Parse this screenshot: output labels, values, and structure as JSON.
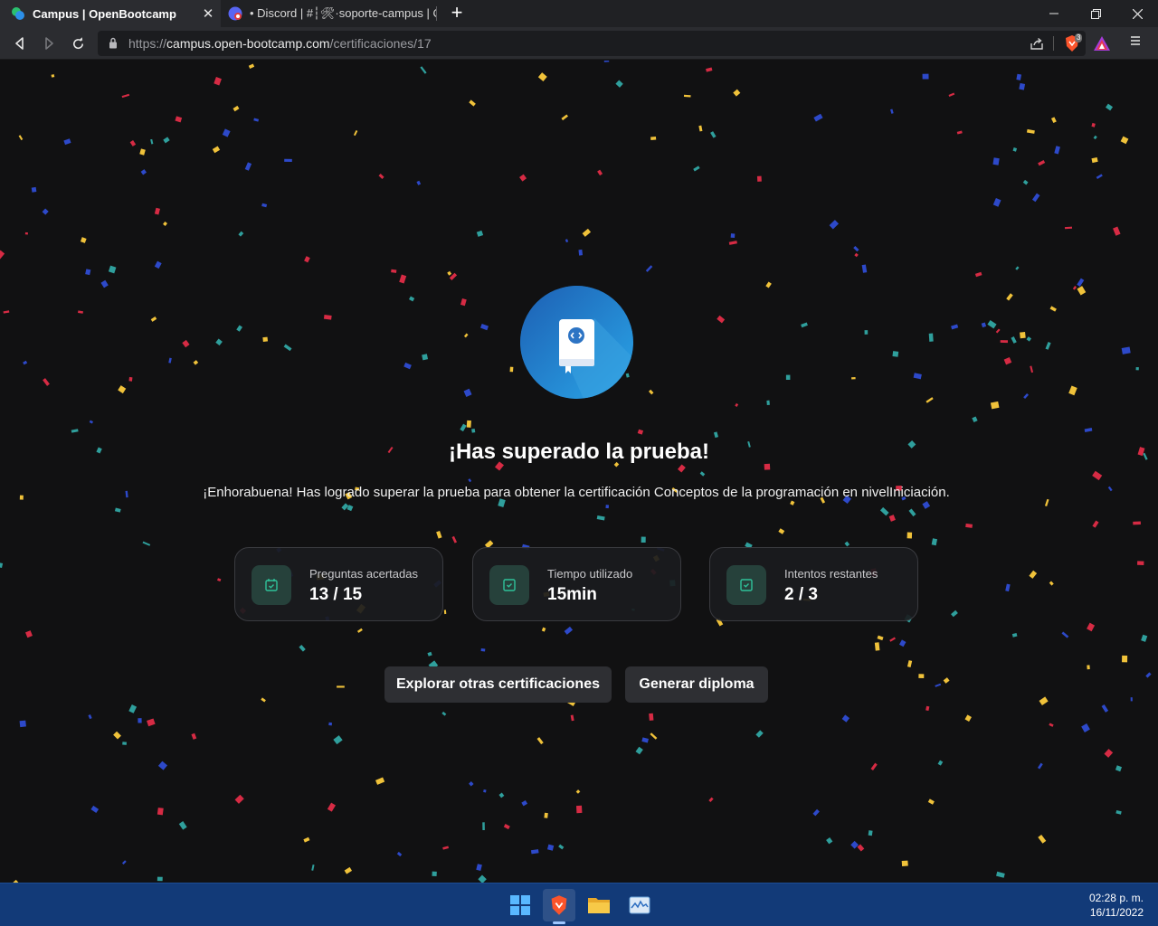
{
  "browser": {
    "tabs": [
      {
        "title": "Campus | OpenBootcamp",
        "active": true,
        "icon": "openbootcamp-favicon"
      },
      {
        "title": "• Discord | #┆🛠·soporte-campus | Op",
        "active": false,
        "icon": "discord-favicon"
      }
    ],
    "url_scheme": "https://",
    "url_host": "campus.open-bootcamp.com",
    "url_path": "/certificaciones/17",
    "shield_badge": "3"
  },
  "page": {
    "headline": "¡Has superado la prueba!",
    "message": "¡Enhorabuena! Has logrado superar la prueba para obtener la certificación Conceptos de la programación en nivelIniciación.",
    "stats": [
      {
        "label": "Preguntas acertadas",
        "value": "13 / 15"
      },
      {
        "label": "Tiempo utilizado",
        "value": "15min"
      },
      {
        "label": "Intentos restantes",
        "value": "2 / 3"
      }
    ],
    "buttons": {
      "explore": "Explorar otras certificaciones",
      "diploma": "Generar diploma"
    },
    "colors": {
      "hero_blue": "#1f6fc0",
      "stat_icon_green": "#2fc29a",
      "confetti": [
        "#d62b44",
        "#2f9f9c",
        "#2d49c9",
        "#f0c23a"
      ]
    }
  },
  "taskbar": {
    "time": "02:28 p. m.",
    "date": "16/11/2022",
    "apps": [
      "windows-start-icon",
      "brave-browser-icon",
      "file-explorer-icon",
      "resource-monitor-icon"
    ]
  }
}
